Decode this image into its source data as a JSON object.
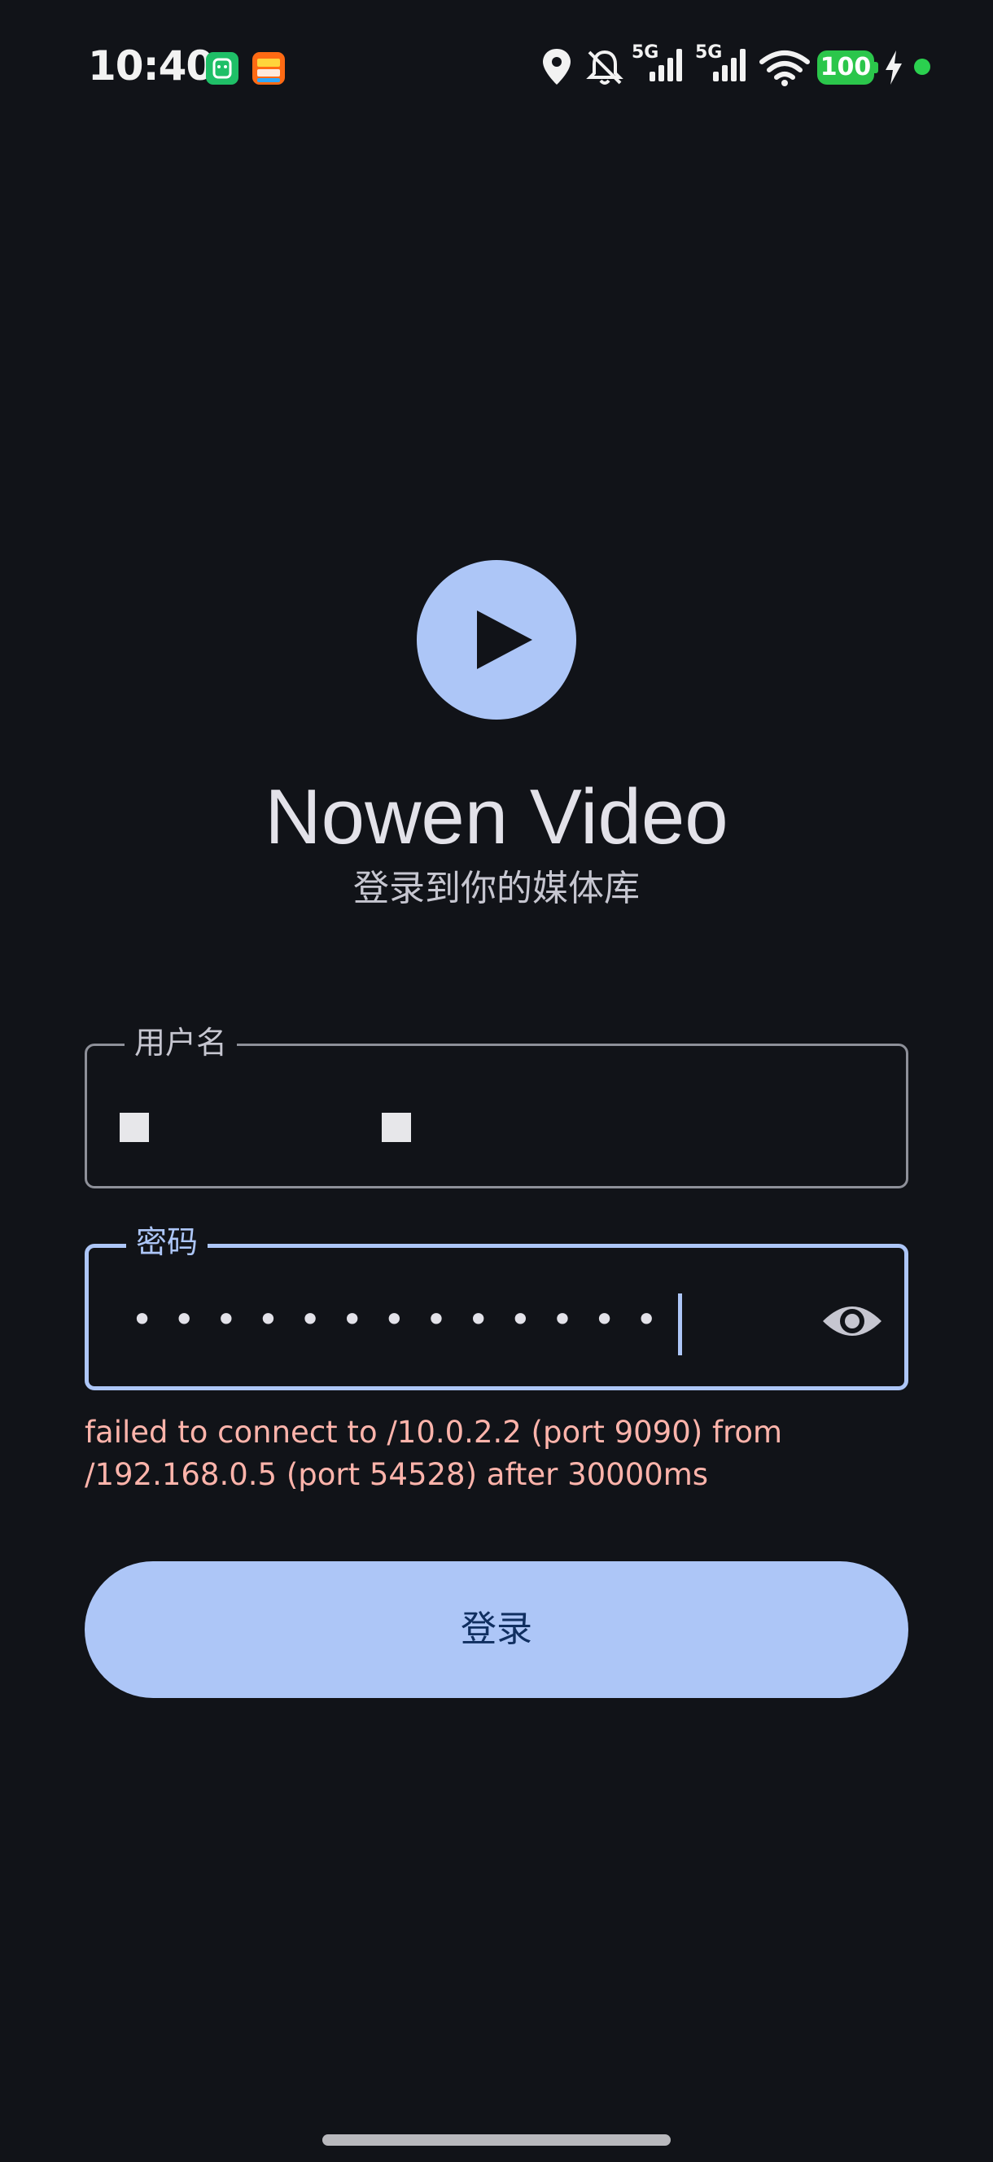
{
  "status_bar": {
    "time": "10:40",
    "battery_level": "100",
    "network_label_1": "5G",
    "network_label_2": "5G"
  },
  "app": {
    "title": "Nowen Video",
    "subtitle": "登录到你的媒体库"
  },
  "form": {
    "username": {
      "label": "用户名",
      "value": ""
    },
    "password": {
      "label": "密码",
      "masked_value": "•••••••••••••"
    },
    "error_message": "failed to connect to /10.0.2.2 (port 9090) from /192.168.0.5 (port 54528) after 30000ms",
    "login_label": "登录"
  },
  "colors": {
    "background": "#111318",
    "primary": "#adc6f7",
    "on_primary": "#102f60",
    "error": "#ffb4ab",
    "outline": "#8e9099",
    "battery": "#2bc64b"
  },
  "icons": {
    "logo": "play-icon",
    "password_toggle": "eye-icon",
    "status": [
      "location-icon",
      "bell-off-icon",
      "signal-icon",
      "signal-icon",
      "wifi-icon",
      "battery-icon",
      "charging-icon"
    ]
  }
}
